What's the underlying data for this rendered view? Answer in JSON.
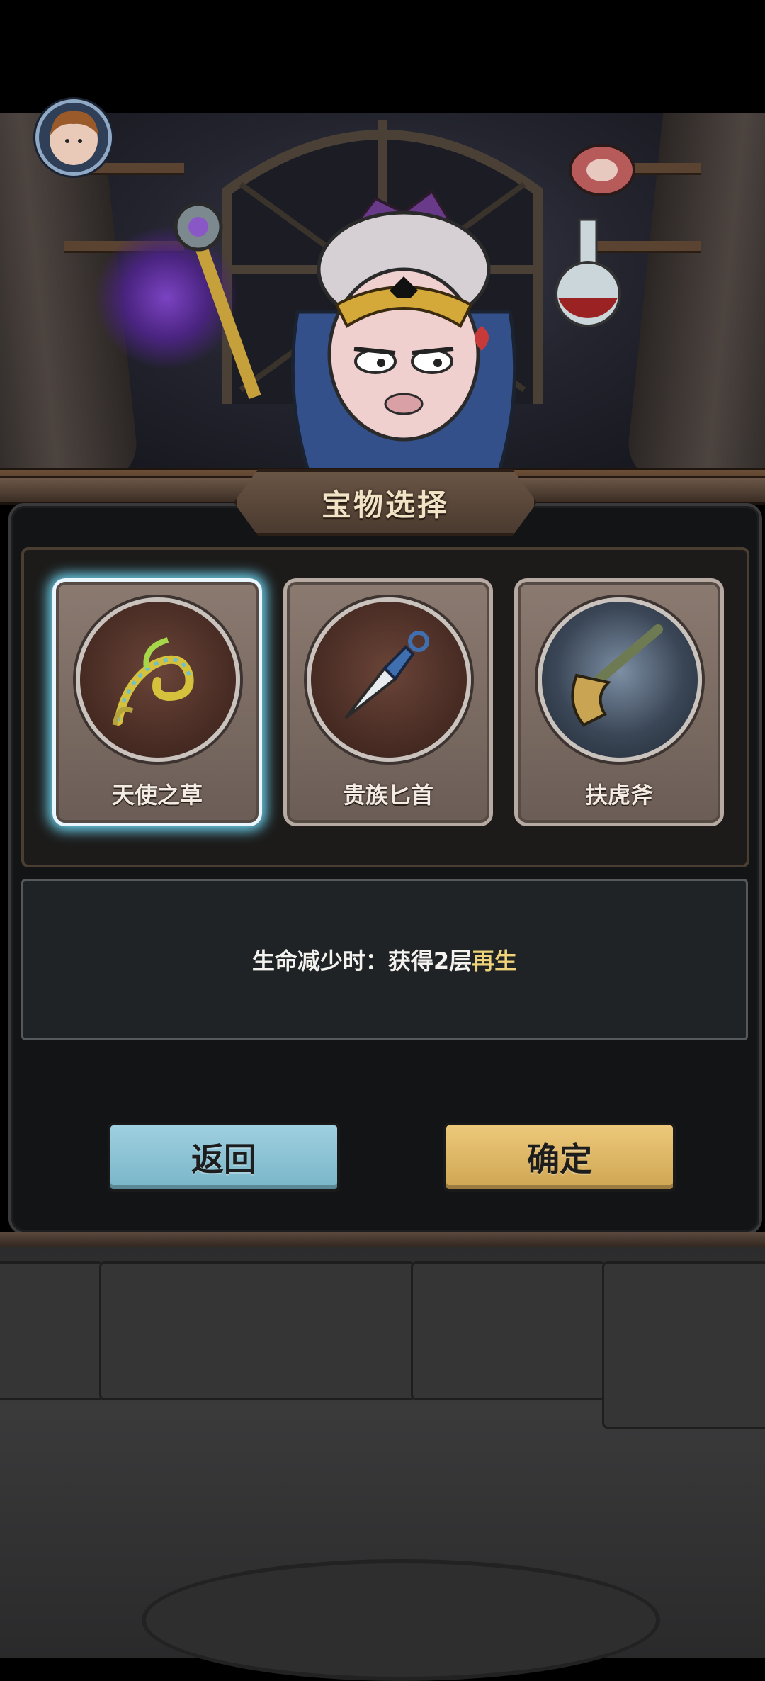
{
  "panel": {
    "title": "宝物选择"
  },
  "items": [
    {
      "name": "天使之草",
      "icon": "fern-sprout-icon",
      "selected": true
    },
    {
      "name": "贵族匕首",
      "icon": "dagger-icon",
      "selected": false
    },
    {
      "name": "扶虎斧",
      "icon": "axe-icon",
      "selected": false
    }
  ],
  "description": {
    "prefix": "生命减少时：获得2层",
    "highlight": "再生"
  },
  "buttons": {
    "back": "返回",
    "confirm": "确定"
  },
  "colors": {
    "selected_glow": "#6ed6f3",
    "back_button": "#8fc6d8",
    "confirm_button": "#e0b868",
    "highlight_text": "#efd37a"
  }
}
